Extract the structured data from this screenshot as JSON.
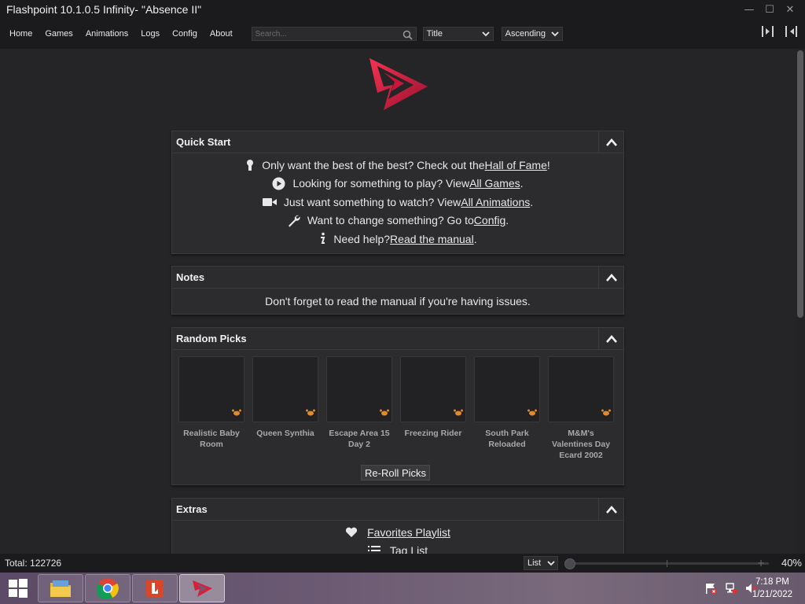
{
  "window": {
    "title": "Flashpoint 10.1.0.5 Infinity- \"Absence II\"",
    "controls": {
      "minimize": "—",
      "maximize": "☐",
      "close": "✕"
    }
  },
  "menu": {
    "items": [
      "Home",
      "Games",
      "Animations",
      "Logs",
      "Config",
      "About"
    ],
    "search_placeholder": "Search...",
    "sort_field": "Title",
    "sort_order": "Ascending"
  },
  "quick_start": {
    "title": "Quick Start",
    "lines": [
      {
        "icon": "award-icon",
        "before": "Only want the best of the best? Check out the ",
        "link": "Hall of Fame",
        "after": "!"
      },
      {
        "icon": "play-circle-icon",
        "before": "Looking for something to play? View ",
        "link": "All Games",
        "after": "."
      },
      {
        "icon": "video-camera-icon",
        "before": "Just want something to watch? View ",
        "link": "All Animations",
        "after": "."
      },
      {
        "icon": "wrench-icon",
        "before": "Want to change something? Go to ",
        "link": "Config",
        "after": "."
      },
      {
        "icon": "info-icon",
        "before": "Need help? ",
        "link": "Read the manual",
        "after": "."
      }
    ]
  },
  "notes": {
    "title": "Notes",
    "text": "Don't forget to read the manual if you're having issues."
  },
  "random_picks": {
    "title": "Random Picks",
    "items": [
      {
        "line1": "Realistic Baby",
        "line2": "Room",
        "line3": ""
      },
      {
        "line1": "Queen Synthia",
        "line2": "",
        "line3": ""
      },
      {
        "line1": "Escape Area 15",
        "line2": "Day 2",
        "line3": ""
      },
      {
        "line1": "Freezing Rider",
        "line2": "",
        "line3": ""
      },
      {
        "line1": "South Park",
        "line2": "Reloaded",
        "line3": ""
      },
      {
        "line1": "M&M's",
        "line2": "Valentines Day",
        "line3": "Ecard 2002"
      }
    ],
    "reroll_label": "Re-Roll Picks"
  },
  "extras": {
    "title": "Extras",
    "lines": [
      {
        "icon": "heart-icon",
        "link": "Favorites Playlist"
      },
      {
        "icon": "list-icon",
        "link": "Tag List"
      }
    ]
  },
  "status": {
    "total": "Total: 122726",
    "view_mode": "List",
    "zoom_percent": "40%",
    "zoom_level": 0.0
  },
  "taskbar": {
    "time": "7:18 PM",
    "date": "1/21/2022"
  },
  "colors": {
    "background": "#252527",
    "panel": "#2c2c2f",
    "chrome": "#1b1b1d",
    "accent": "#d81e3a"
  }
}
